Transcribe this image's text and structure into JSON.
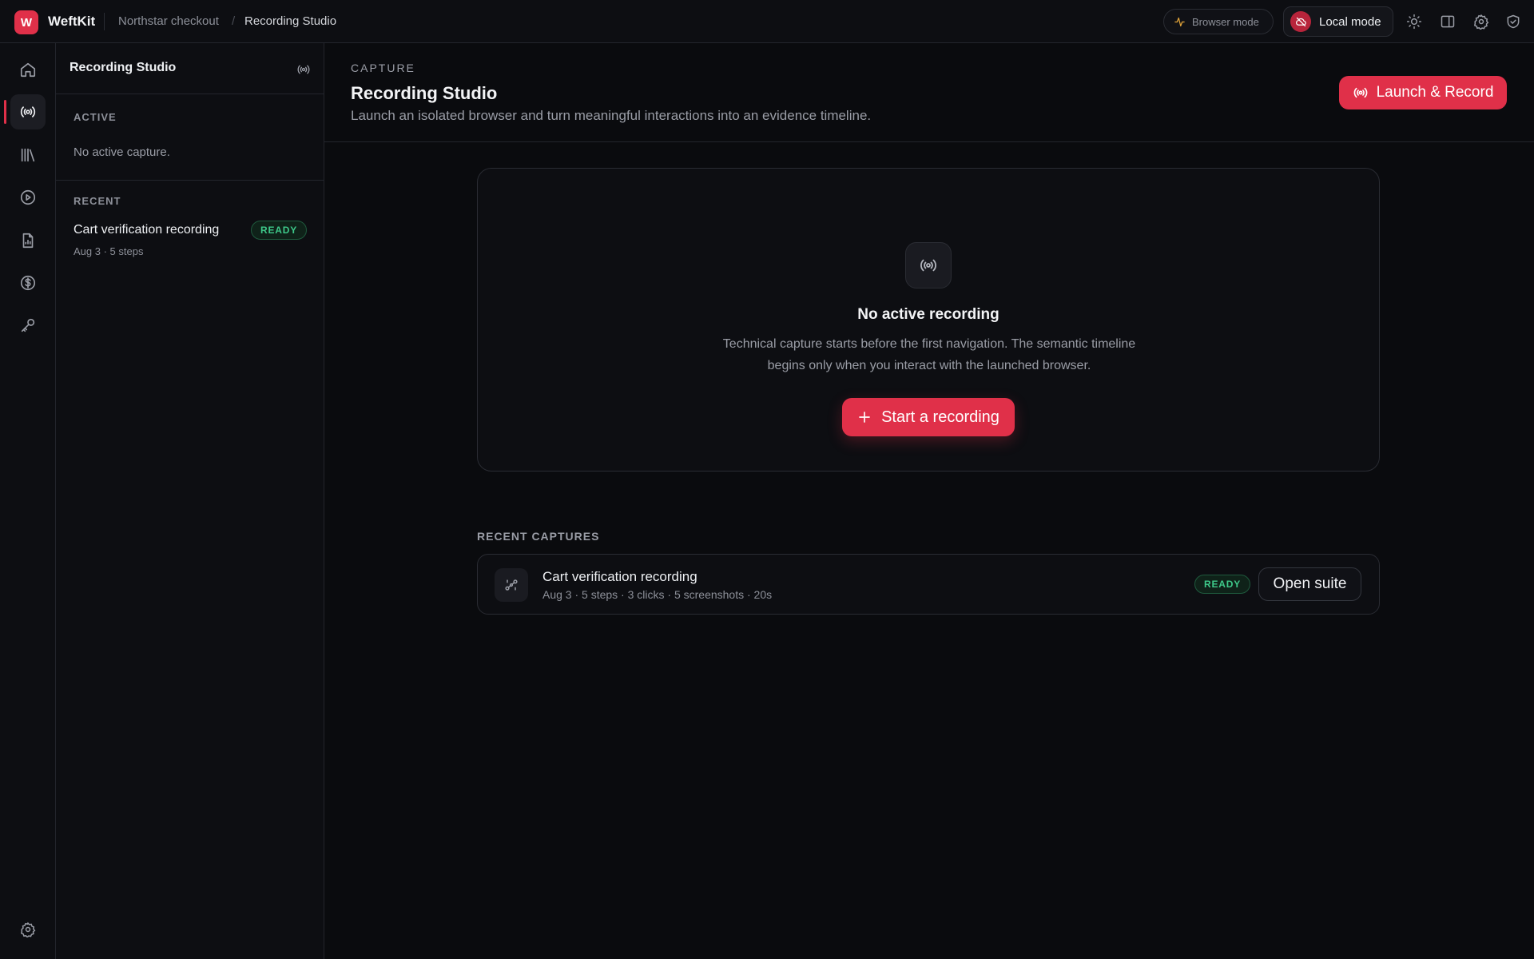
{
  "app": {
    "logo_letter": "W",
    "name": "WeftKit",
    "brand_color": "#e03049"
  },
  "breadcrumb": {
    "project": "Northstar checkout",
    "separator": "/",
    "current": "Recording Studio"
  },
  "topbar": {
    "browser_mode_label": "Browser mode",
    "local_mode_label": "Local mode",
    "icons": [
      "sun-icon",
      "panel-icon",
      "gear-icon",
      "shield-icon"
    ]
  },
  "rail": {
    "items": [
      "home-icon",
      "broadcast-icon",
      "library-icon",
      "play-icon",
      "report-icon",
      "dollar-icon",
      "key-icon"
    ],
    "active": "broadcast-icon",
    "bottom": "gear-icon"
  },
  "sidebar": {
    "title": "Recording Studio",
    "active_label": "ACTIVE",
    "active_empty": "No active capture.",
    "recent_label": "RECENT",
    "recent_items": [
      {
        "title": "Cart verification recording",
        "meta": "Aug 3 · 5 steps",
        "status": "READY"
      }
    ]
  },
  "main": {
    "eyebrow": "CAPTURE",
    "title": "Recording Studio",
    "description": "Launch an isolated browser and turn meaningful interactions into an evidence timeline.",
    "launch_button": "Launch & Record",
    "empty": {
      "title": "No active recording",
      "description": "Technical capture starts before the first navigation. The semantic timeline begins only when you interact with the launched browser.",
      "start_button": "Start a recording"
    },
    "recent_label": "RECENT CAPTURES",
    "captures": [
      {
        "title": "Cart verification recording",
        "meta": "Aug 3 · 5 steps · 3 clicks · 5 screenshots · 20s",
        "status": "READY",
        "action": "Open suite"
      }
    ]
  }
}
